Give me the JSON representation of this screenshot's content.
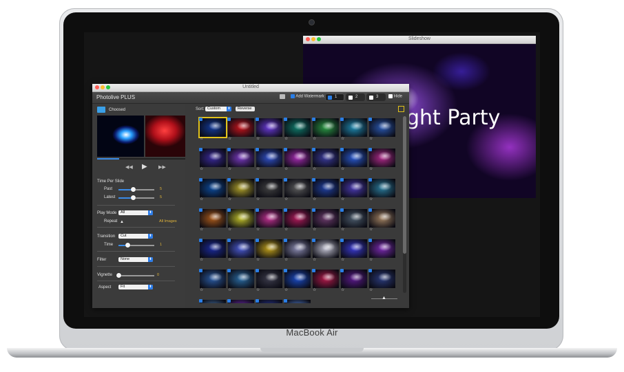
{
  "laptop": {
    "brand_label": "MacBook Air"
  },
  "slideshow_window": {
    "title": "Slideshow",
    "overlay_text": "ght Party"
  },
  "main_window": {
    "window_title": "Untitled",
    "app_title": "Photolive PLUS",
    "toolbar": {
      "add_watermark_label": "Add Watermark",
      "add_watermark_checked": true,
      "tabs": [
        {
          "label": "1",
          "checked": true
        },
        {
          "label": "2",
          "checked": false
        },
        {
          "label": "3",
          "checked": false
        }
      ],
      "hide_label": "Hide"
    },
    "folder": {
      "label": "Choosed"
    },
    "playback": {
      "prev_icon": "rewind-icon",
      "play_icon": "play-icon",
      "next_icon": "fast-forward-icon"
    },
    "time_per_slide": {
      "heading": "Time Per Slide",
      "past_label": "Past",
      "past_value": "5",
      "past_fraction": 0.4,
      "latest_label": "Latest",
      "latest_value": "5",
      "latest_fraction": 0.4
    },
    "play_mode": {
      "label": "Play Mode",
      "value": "All",
      "repeat_label": "Repeat",
      "repeat_value": "All Images"
    },
    "transition": {
      "label": "Transition",
      "value": "Cut",
      "time_label": "Time",
      "time_value": "1",
      "time_fraction": 0.25
    },
    "filter": {
      "label": "Filter",
      "value": "None"
    },
    "vignette": {
      "label": "Vignette",
      "value": "0",
      "fraction": 0.0
    },
    "aspect": {
      "label": "Aspect",
      "value": "Fit"
    },
    "sort": {
      "label": "Sort:",
      "value": "Custom",
      "reverse_label": "Reverse"
    },
    "grid": {
      "colors": [
        [
          "#123a9a",
          "#c8141c",
          "#6a3ad8",
          "#0f7a6a",
          "#2b9a44",
          "#1f8ab0",
          "#2a58b0"
        ],
        [
          "#3a2a9a",
          "#7a3ac0",
          "#3050c8",
          "#a52bb0",
          "#3a3a9a",
          "#2a5ad0",
          "#b02a8a"
        ],
        [
          "#0c4a9a",
          "#b0a22a",
          "#404040",
          "#5a5a5a",
          "#2040a0",
          "#4a3ab0",
          "#2a7a9a"
        ],
        [
          "#aa5a1a",
          "#c0c02a",
          "#c03090",
          "#b01a5a",
          "#6a3a6a",
          "#4a5a6a",
          "#a08060"
        ],
        [
          "#1a2a9a",
          "#4a5ad0",
          "#c0a01a",
          "#8a8ab0",
          "#c0c0d0",
          "#3a3ad0",
          "#7a2ab0"
        ],
        [
          "#2a5aa0",
          "#2a6aa0",
          "#3a3a4a",
          "#1a4ac0",
          "#b01a4a",
          "#5a1a8a",
          "#2a3a7a"
        ],
        [
          "#4a7ab0",
          "#7a2ac0",
          "#2a3aa0",
          "#5a8ae0"
        ]
      ]
    }
  }
}
